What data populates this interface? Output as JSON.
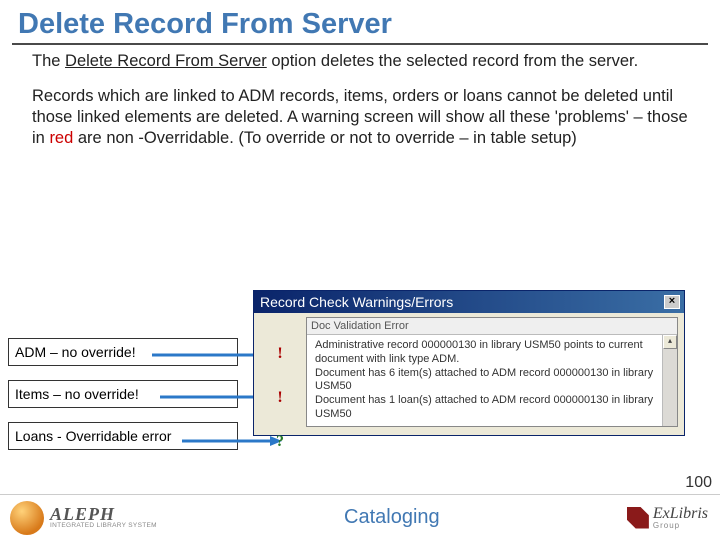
{
  "title": "Delete Record From Server",
  "para1_pre": "The ",
  "para1_ul": "Delete Record From Server",
  "para1_post": " option deletes the selected record from the server.",
  "para2_a": "Records which are linked to ADM records, items, orders or loans cannot be deleted until those linked elements are deleted. A warning screen will show all these 'problems' – those in ",
  "para2_red": "red",
  "para2_b": " are non -Overridable. (To override or not to override – in table setup)",
  "callouts": {
    "adm": "ADM – no override!",
    "items": "Items – no override!",
    "loans": "Loans - Overridable error"
  },
  "dialog": {
    "title": "Record Check Warnings/Errors",
    "close": "×",
    "panel_header": "Doc Validation Error",
    "msg1": "Administrative record 000000130 in library USM50 points to current document with link type ADM.",
    "msg2": "Document has 6 item(s) attached to ADM record 000000130 in library USM50",
    "msg3": "Document has 1 loan(s) attached to ADM record 000000130 in library USM50",
    "scroll_up": "▴"
  },
  "footer": {
    "aleph_name": "ALEPH",
    "aleph_sub": "INTEGRATED LIBRARY SYSTEM",
    "center": "Cataloging",
    "ex_name": "ExLibris",
    "ex_sub": "Group"
  },
  "page_num": "100"
}
